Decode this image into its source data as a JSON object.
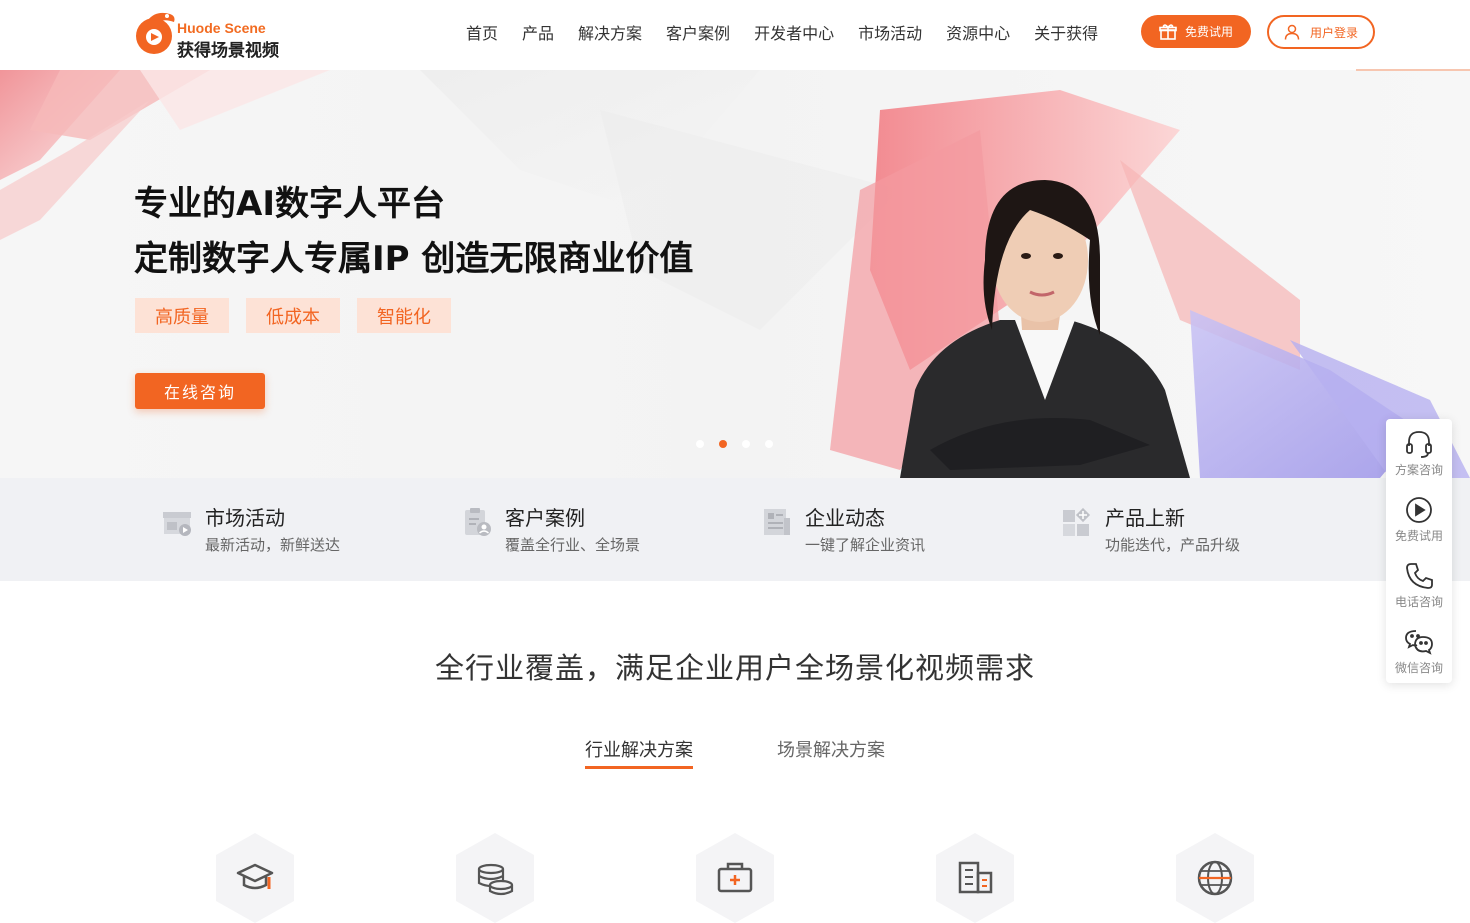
{
  "brand": {
    "logo_en": "Huode Scene",
    "logo_cn": "获得场景视频",
    "accent": "#f26522"
  },
  "nav": {
    "items": [
      "首页",
      "产品",
      "解决方案",
      "客户案例",
      "开发者中心",
      "市场活动",
      "资源中心",
      "关于获得"
    ],
    "trial_label": "免费试用",
    "login_label": "用户登录"
  },
  "hero": {
    "title_line1": "专业的AI数字人平台",
    "title_line2": "定制数字人专属IP 创造无限商业价值",
    "tags": [
      "高质量",
      "低成本",
      "智能化"
    ],
    "cta_label": "在线咨询",
    "slides_total": 4,
    "active_slide": 2
  },
  "quick_links": [
    {
      "icon": "storefront-icon",
      "title": "市场活动",
      "subtitle": "最新活动，新鲜送达"
    },
    {
      "icon": "clipboard-user-icon",
      "title": "客户案例",
      "subtitle": "覆盖全行业、全场景"
    },
    {
      "icon": "news-icon",
      "title": "企业动态",
      "subtitle": "一键了解企业资讯"
    },
    {
      "icon": "apps-plus-icon",
      "title": "产品上新",
      "subtitle": "功能迭代，产品升级"
    }
  ],
  "section": {
    "title": "全行业覆盖，满足企业用户全场景化视频需求",
    "tabs": [
      "行业解决方案",
      "场景解决方案"
    ],
    "active_tab": 0,
    "industry_icons": [
      "graduation-cap-icon",
      "coins-icon",
      "medical-kit-icon",
      "building-icon",
      "globe-icon"
    ]
  },
  "side_widget": [
    {
      "icon": "headset-icon",
      "label": "方案咨询"
    },
    {
      "icon": "play-circle-icon",
      "label": "免费试用"
    },
    {
      "icon": "phone-icon",
      "label": "电话咨询"
    },
    {
      "icon": "wechat-icon",
      "label": "微信咨询"
    }
  ]
}
